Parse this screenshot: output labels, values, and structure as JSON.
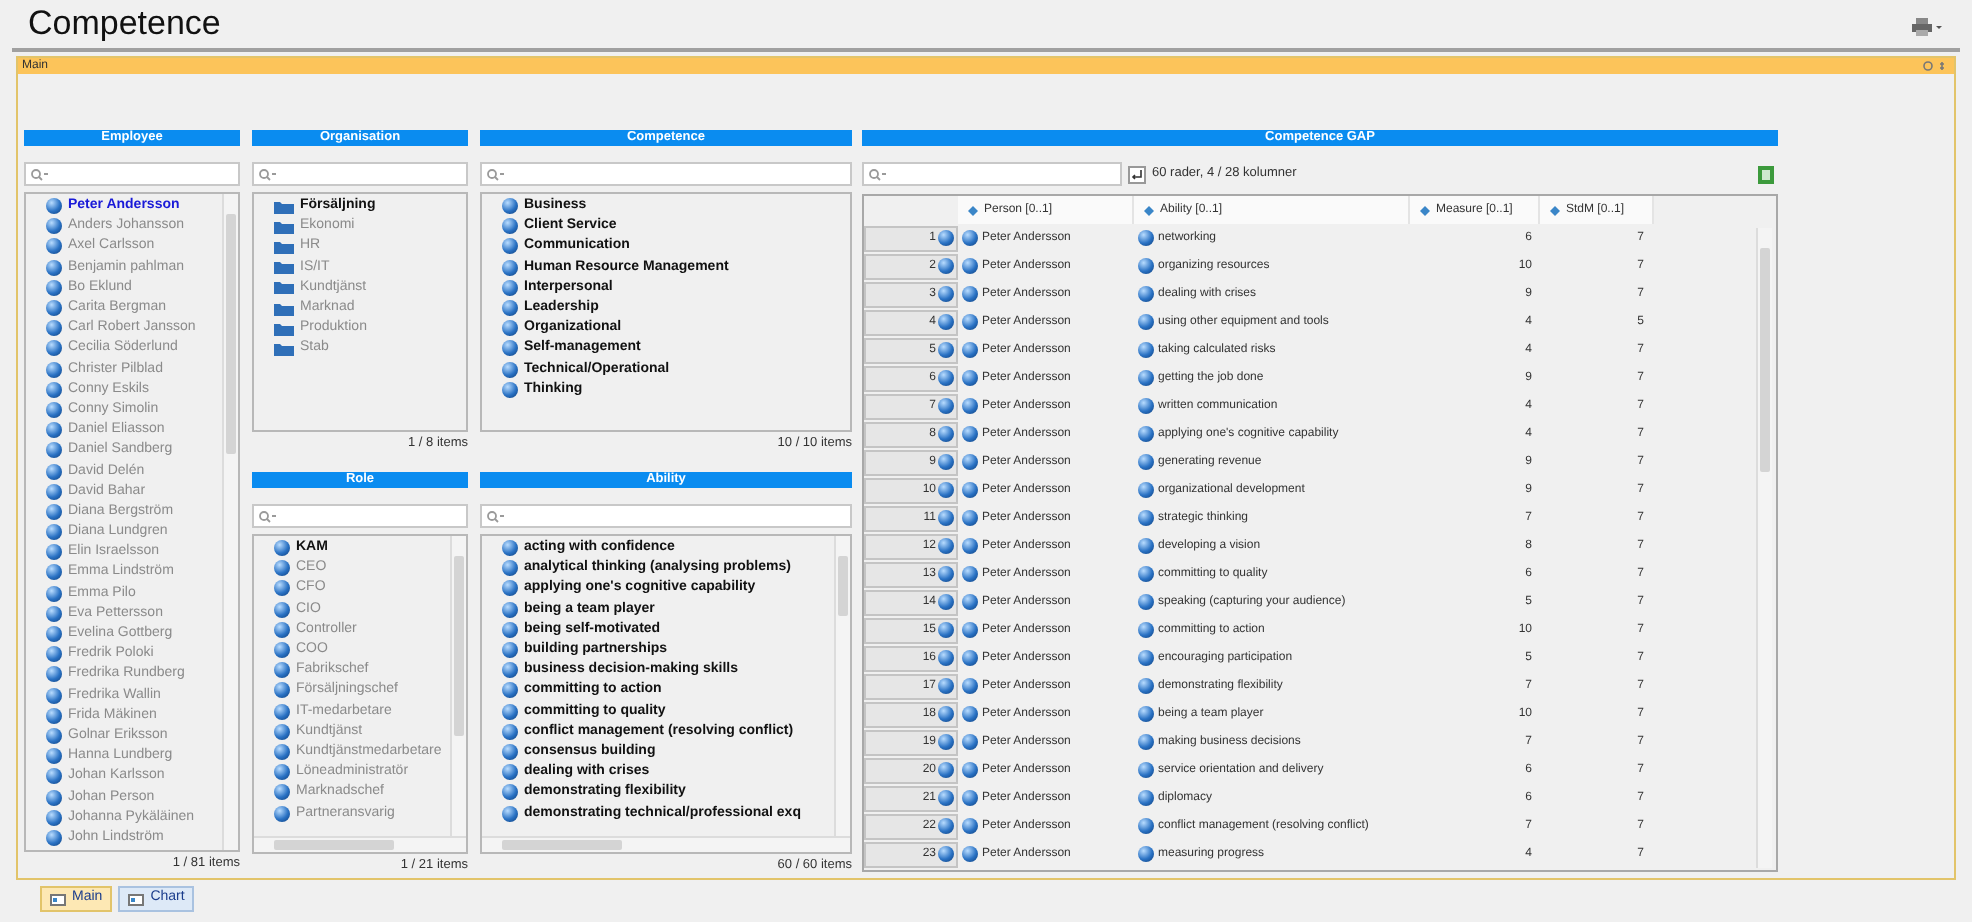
{
  "title": "Competence",
  "main_panel": {
    "title": "Main"
  },
  "employee": {
    "header": "Employee",
    "footer": "1 / 81 items",
    "items": [
      {
        "label": "Peter Andersson",
        "selected": true
      },
      {
        "label": "Anders Johansson",
        "selected": false
      },
      {
        "label": "Axel Carlsson",
        "selected": false
      },
      {
        "label": "Benjamin pahlman",
        "selected": false
      },
      {
        "label": "Bo Eklund",
        "selected": false
      },
      {
        "label": "Carita Bergman",
        "selected": false
      },
      {
        "label": "Carl Robert Jansson",
        "selected": false
      },
      {
        "label": "Cecilia Söderlund",
        "selected": false
      },
      {
        "label": "Christer Pilblad",
        "selected": false
      },
      {
        "label": "Conny Eskils",
        "selected": false
      },
      {
        "label": "Conny Simolin",
        "selected": false
      },
      {
        "label": "Daniel Eliasson",
        "selected": false
      },
      {
        "label": "Daniel Sandberg",
        "selected": false
      },
      {
        "label": "David Delén",
        "selected": false
      },
      {
        "label": "David Bahar",
        "selected": false
      },
      {
        "label": "Diana Bergström",
        "selected": false
      },
      {
        "label": "Diana Lundgren",
        "selected": false
      },
      {
        "label": "Elin Israelsson",
        "selected": false
      },
      {
        "label": "Emma Lindström",
        "selected": false
      },
      {
        "label": "Emma Pilo",
        "selected": false
      },
      {
        "label": "Eva Pettersson",
        "selected": false
      },
      {
        "label": "Evelina Gottberg",
        "selected": false
      },
      {
        "label": "Fredrik Poloki",
        "selected": false
      },
      {
        "label": "Fredrika Rundberg",
        "selected": false
      },
      {
        "label": "Fredrika Wallin",
        "selected": false
      },
      {
        "label": "Frida Mäkinen",
        "selected": false
      },
      {
        "label": "Golnar Eriksson",
        "selected": false
      },
      {
        "label": "Hanna Lundberg",
        "selected": false
      },
      {
        "label": "Johan Karlsson",
        "selected": false
      },
      {
        "label": "Johan Person",
        "selected": false
      },
      {
        "label": "Johanna Pykäläinen",
        "selected": false
      },
      {
        "label": "John Lindström",
        "selected": false
      }
    ]
  },
  "organisation": {
    "header": "Organisation",
    "footer": "1 / 8 items",
    "items": [
      {
        "label": "Försäljning",
        "selected": true
      },
      {
        "label": "Ekonomi",
        "selected": false
      },
      {
        "label": "HR",
        "selected": false
      },
      {
        "label": "IS/IT",
        "selected": false
      },
      {
        "label": "Kundtjänst",
        "selected": false
      },
      {
        "label": "Marknad",
        "selected": false
      },
      {
        "label": "Produktion",
        "selected": false
      },
      {
        "label": "Stab",
        "selected": false
      }
    ]
  },
  "role": {
    "header": "Role",
    "footer": "1 / 21 items",
    "items": [
      {
        "label": "KAM",
        "selected": true
      },
      {
        "label": "CEO",
        "selected": false
      },
      {
        "label": "CFO",
        "selected": false
      },
      {
        "label": "CIO",
        "selected": false
      },
      {
        "label": "Controller",
        "selected": false
      },
      {
        "label": "COO",
        "selected": false
      },
      {
        "label": "Fabrikschef",
        "selected": false
      },
      {
        "label": "Försäljningschef",
        "selected": false
      },
      {
        "label": "IT-medarbetare",
        "selected": false
      },
      {
        "label": "Kundtjänst",
        "selected": false
      },
      {
        "label": "Kundtjänstmedarbetare",
        "selected": false
      },
      {
        "label": "Löneadministratör",
        "selected": false
      },
      {
        "label": "Marknadschef",
        "selected": false
      },
      {
        "label": "Partneransvarig",
        "selected": false
      }
    ]
  },
  "competence": {
    "header": "Competence",
    "footer": "10 / 10 items",
    "items": [
      "Business",
      "Client Service",
      "Communication",
      "Human Resource Management",
      "Interpersonal",
      "Leadership",
      "Organizational",
      "Self-management",
      "Technical/Operational",
      "Thinking"
    ]
  },
  "ability": {
    "header": "Ability",
    "footer": "60 / 60 items",
    "items": [
      "acting with confidence",
      "analytical thinking (analysing problems)",
      "applying one's cognitive capability",
      "being a team player",
      "being self-motivated",
      "building partnerships",
      "business decision-making skills",
      "committing to action",
      "committing to quality",
      "conflict management (resolving conflict)",
      "consensus building",
      "dealing with crises",
      "demonstrating flexibility",
      "demonstrating technical/professional exq"
    ]
  },
  "gap": {
    "header": "Competence GAP",
    "summary": "60 rader, 4 / 28 kolumner",
    "columns": [
      "Person [0..1]",
      "Ability [0..1]",
      "Measure [0..1]",
      "StdM [0..1]"
    ],
    "rows": [
      {
        "n": "1",
        "person": "Peter Andersson",
        "ability": "networking",
        "measure": "6",
        "stdm": "7"
      },
      {
        "n": "2",
        "person": "Peter Andersson",
        "ability": "organizing resources",
        "measure": "10",
        "stdm": "7"
      },
      {
        "n": "3",
        "person": "Peter Andersson",
        "ability": "dealing with crises",
        "measure": "9",
        "stdm": "7"
      },
      {
        "n": "4",
        "person": "Peter Andersson",
        "ability": "using other equipment and tools",
        "measure": "4",
        "stdm": "5"
      },
      {
        "n": "5",
        "person": "Peter Andersson",
        "ability": "taking calculated risks",
        "measure": "4",
        "stdm": "7"
      },
      {
        "n": "6",
        "person": "Peter Andersson",
        "ability": "getting the job done",
        "measure": "9",
        "stdm": "7"
      },
      {
        "n": "7",
        "person": "Peter Andersson",
        "ability": "written communication",
        "measure": "4",
        "stdm": "7"
      },
      {
        "n": "8",
        "person": "Peter Andersson",
        "ability": "applying one's cognitive capability",
        "measure": "4",
        "stdm": "7"
      },
      {
        "n": "9",
        "person": "Peter Andersson",
        "ability": "generating revenue",
        "measure": "9",
        "stdm": "7"
      },
      {
        "n": "10",
        "person": "Peter Andersson",
        "ability": "organizational development",
        "measure": "9",
        "stdm": "7"
      },
      {
        "n": "11",
        "person": "Peter Andersson",
        "ability": "strategic thinking",
        "measure": "7",
        "stdm": "7"
      },
      {
        "n": "12",
        "person": "Peter Andersson",
        "ability": "developing a vision",
        "measure": "8",
        "stdm": "7"
      },
      {
        "n": "13",
        "person": "Peter Andersson",
        "ability": "committing to quality",
        "measure": "6",
        "stdm": "7"
      },
      {
        "n": "14",
        "person": "Peter Andersson",
        "ability": "speaking (capturing your audience)",
        "measure": "5",
        "stdm": "7"
      },
      {
        "n": "15",
        "person": "Peter Andersson",
        "ability": "committing to action",
        "measure": "10",
        "stdm": "7"
      },
      {
        "n": "16",
        "person": "Peter Andersson",
        "ability": "encouraging participation",
        "measure": "5",
        "stdm": "7"
      },
      {
        "n": "17",
        "person": "Peter Andersson",
        "ability": "demonstrating flexibility",
        "measure": "7",
        "stdm": "7"
      },
      {
        "n": "18",
        "person": "Peter Andersson",
        "ability": "being a team player",
        "measure": "10",
        "stdm": "7"
      },
      {
        "n": "19",
        "person": "Peter Andersson",
        "ability": "making business decisions",
        "measure": "7",
        "stdm": "7"
      },
      {
        "n": "20",
        "person": "Peter Andersson",
        "ability": "service orientation and delivery",
        "measure": "6",
        "stdm": "7"
      },
      {
        "n": "21",
        "person": "Peter Andersson",
        "ability": "diplomacy",
        "measure": "6",
        "stdm": "7"
      },
      {
        "n": "22",
        "person": "Peter Andersson",
        "ability": "conflict management (resolving conflict)",
        "measure": "7",
        "stdm": "7"
      },
      {
        "n": "23",
        "person": "Peter Andersson",
        "ability": "measuring progress",
        "measure": "4",
        "stdm": "7"
      }
    ]
  },
  "bottom_tabs": [
    {
      "label": "Main",
      "selected": true
    },
    {
      "label": "Chart",
      "selected": false
    }
  ]
}
